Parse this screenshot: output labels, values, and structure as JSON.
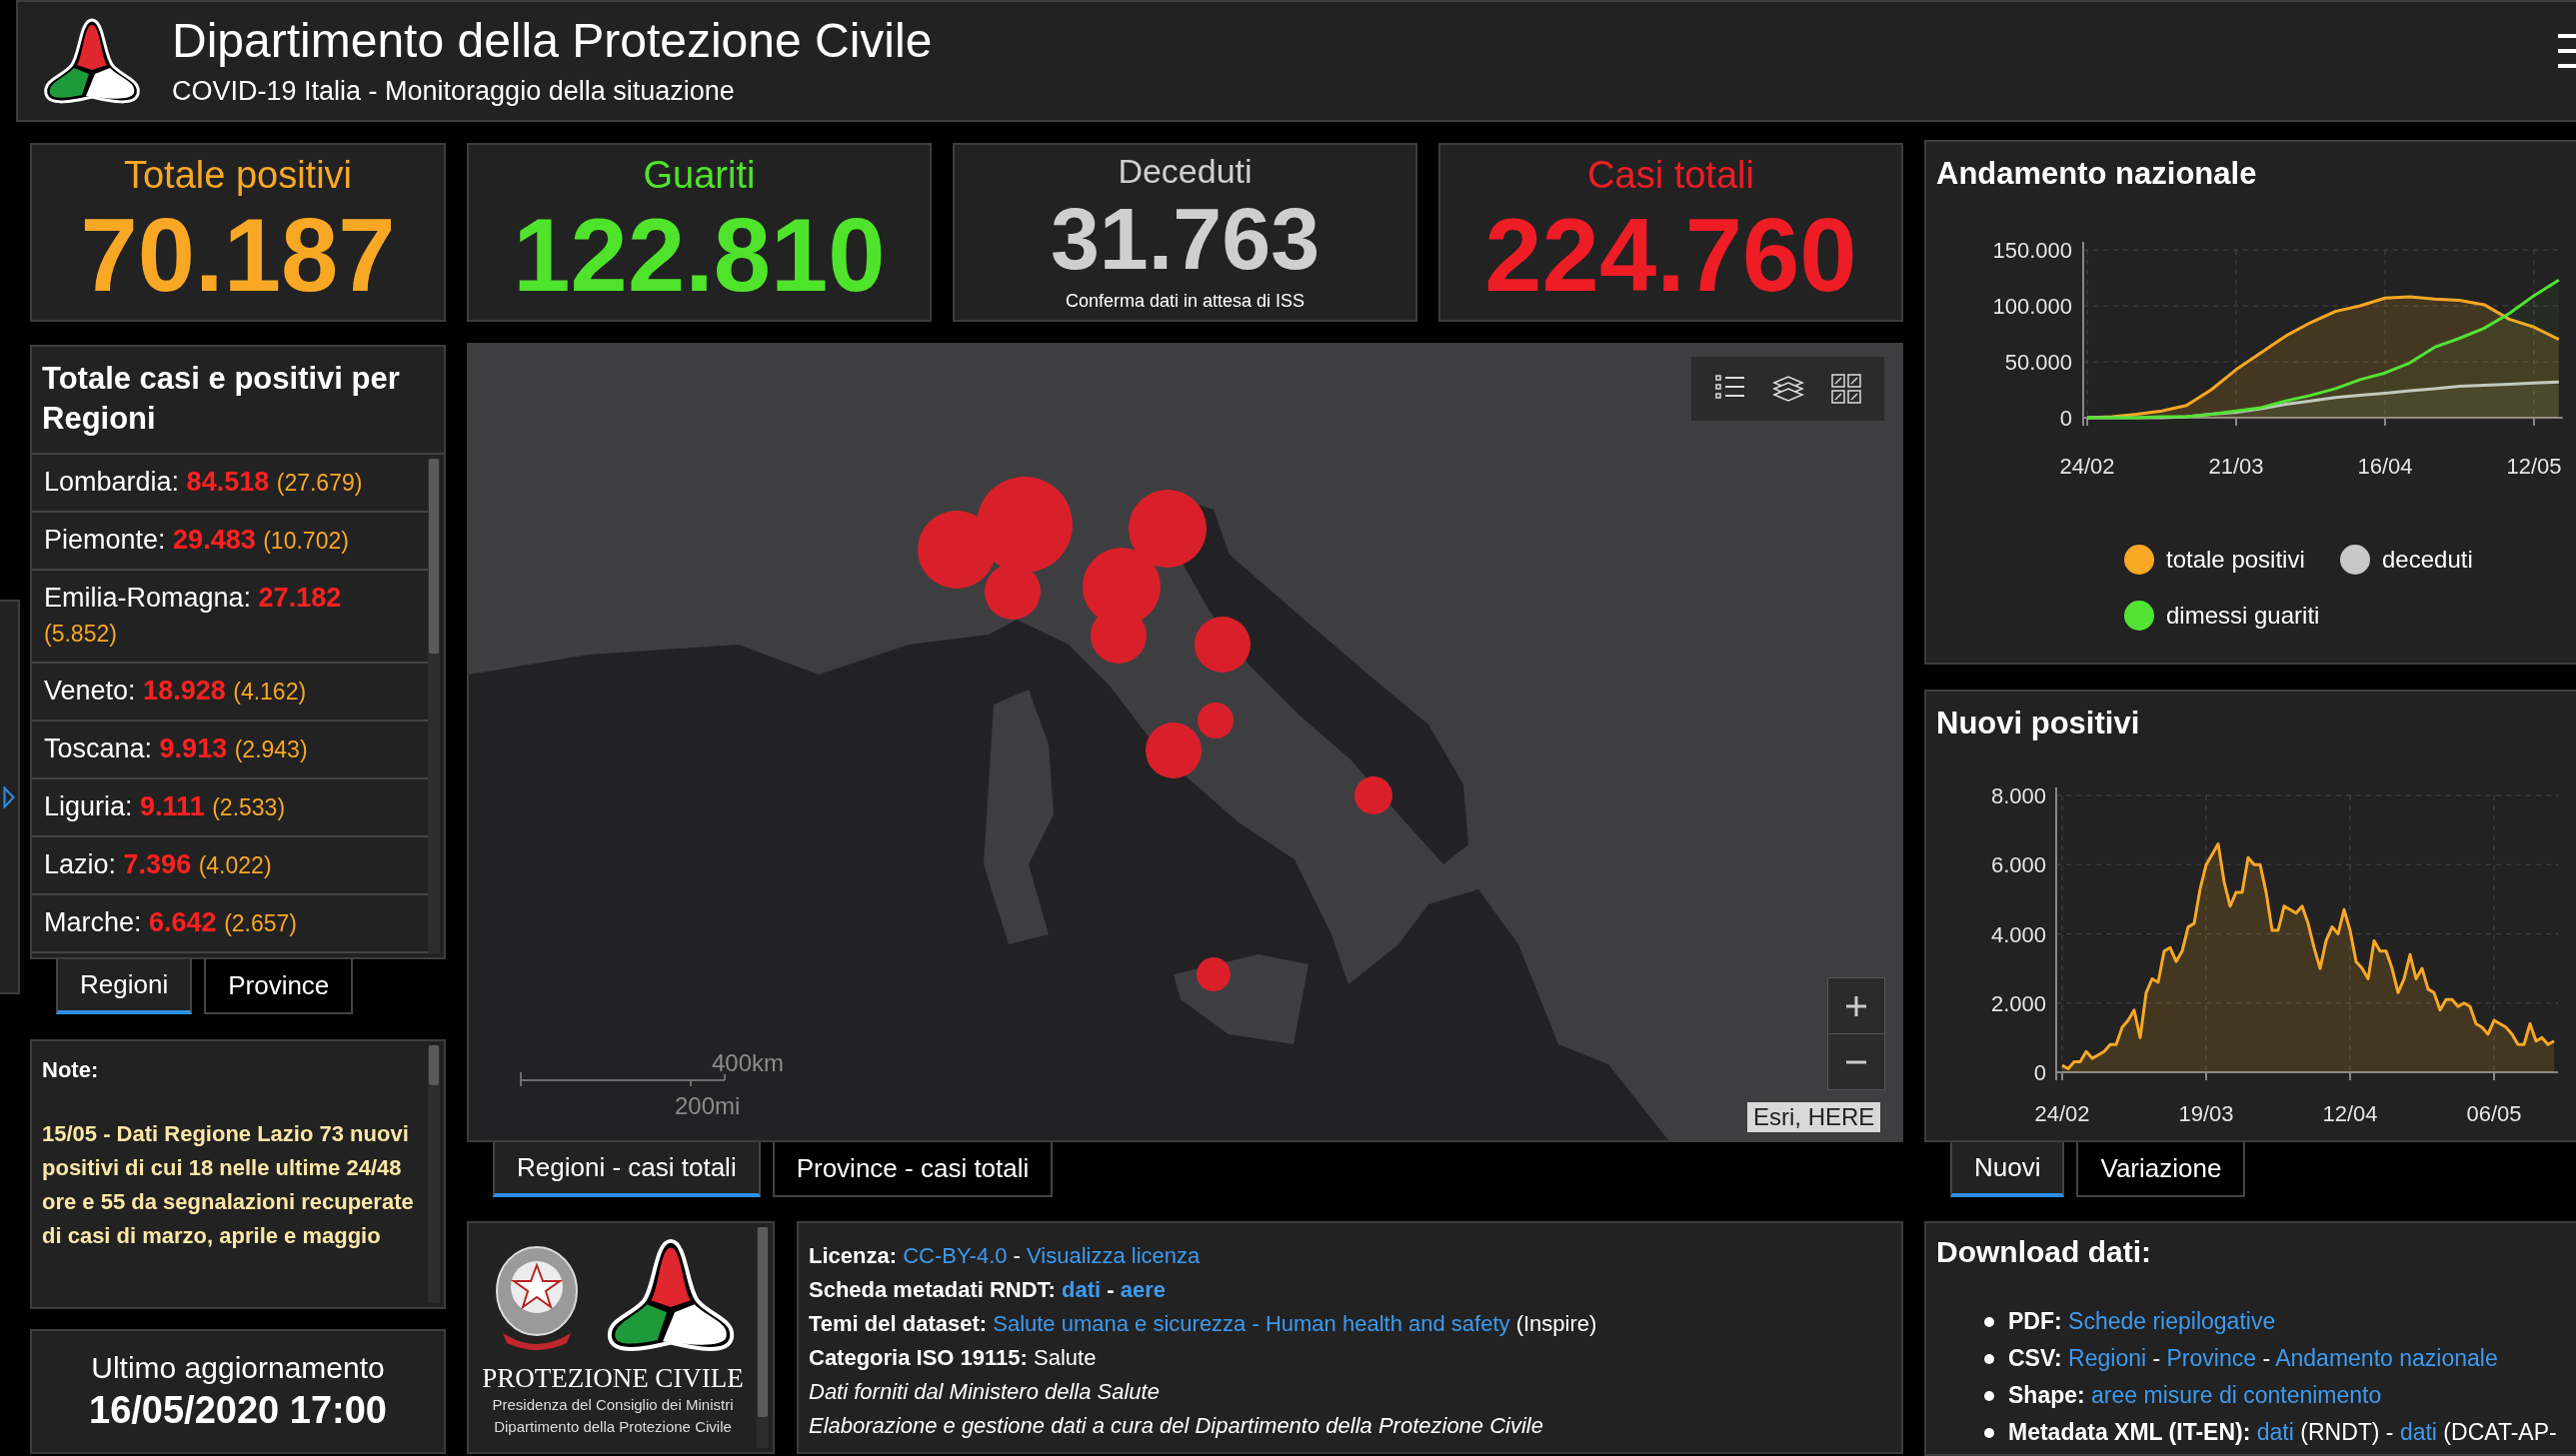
{
  "header": {
    "title": "Dipartimento della Protezione Civile",
    "subtitle": "COVID-19 Italia - Monitoraggio della situazione"
  },
  "stats": [
    {
      "title": "Totale positivi",
      "value": "70.187",
      "color": "#f9a825"
    },
    {
      "title": "Guariti",
      "value": "122.810",
      "color": "#4fe32b"
    },
    {
      "title": "Deceduti",
      "value": "31.763",
      "note": "Conferma dati in attesa di ISS",
      "color": "#cfcfcf"
    },
    {
      "title": "Casi totali",
      "value": "224.760",
      "color": "#ee1c25"
    }
  ],
  "regions_panel": {
    "title": "Totale casi e positivi per Regioni",
    "rows": [
      {
        "name": "Lombardia:",
        "total": "84.518",
        "positives": "(27.679)"
      },
      {
        "name": "Piemonte:",
        "total": "29.483",
        "positives": "(10.702)"
      },
      {
        "name": "Emilia-Romagna:",
        "total": "27.182",
        "positives": "(5.852)"
      },
      {
        "name": "Veneto:",
        "total": "18.928",
        "positives": "(4.162)"
      },
      {
        "name": "Toscana:",
        "total": "9.913",
        "positives": "(2.943)"
      },
      {
        "name": "Liguria:",
        "total": "9.111",
        "positives": "(2.533)"
      },
      {
        "name": "Lazio:",
        "total": "7.396",
        "positives": "(4.022)"
      },
      {
        "name": "Marche:",
        "total": "6.642",
        "positives": "(2.657)"
      }
    ],
    "tabs": [
      {
        "label": "Regioni",
        "selected": true
      },
      {
        "label": "Province",
        "selected": false
      }
    ]
  },
  "notes": {
    "heading": "Note:",
    "text": "15/05 - Dati Regione Lazio 73 nuovi positivi di cui 18 nelle ultime 24/48 ore e 55 da segnalazioni recuperate di casi di marzo, aprile e maggio"
  },
  "update": {
    "label": "Ultimo aggiornamento",
    "value": "16/05/2020 17:00"
  },
  "map": {
    "kind": "picture",
    "scale": [
      "400km",
      "200mi"
    ],
    "attribution": "Esri, HERE",
    "tabs": [
      {
        "label": "Regioni - casi totali",
        "selected": true
      },
      {
        "label": "Province - casi totali",
        "selected": false
      }
    ]
  },
  "logos": {
    "name": "PROTEZIONE CIVILE",
    "lines": [
      "Presidenza del Consiglio dei Ministri",
      "Dipartimento della Protezione Civile"
    ]
  },
  "info": {
    "lines": [
      {
        "kind": "field",
        "bold": false,
        "label": "Licenza:",
        "parts": [
          {
            "kind": "link",
            "text": "CC-BY-4.0"
          },
          {
            "kind": "text",
            "text": " - "
          },
          {
            "kind": "link",
            "text": "Visualizza licenza"
          }
        ]
      },
      {
        "kind": "field",
        "bold": true,
        "label": "Scheda metadati RNDT:",
        "parts": [
          {
            "kind": "link",
            "text": "dati"
          },
          {
            "kind": "text",
            "text": " - "
          },
          {
            "kind": "link",
            "text": "aere"
          }
        ]
      },
      {
        "kind": "field",
        "bold": false,
        "label": "Temi del dataset:",
        "parts": [
          {
            "kind": "link",
            "text": "Salute umana e sicurezza - Human health and safety"
          },
          {
            "kind": "text",
            "text": " (Inspire)"
          }
        ]
      },
      {
        "kind": "field",
        "bold": false,
        "label": "Categoria ISO 19115:",
        "parts": [
          {
            "kind": "text",
            "text": "Salute"
          }
        ]
      },
      {
        "kind": "italic",
        "text": "Dati forniti dal Ministero della Salute"
      },
      {
        "kind": "italic",
        "text": "Elaborazione e gestione dati a cura del Dipartimento della Protezione Civile"
      }
    ]
  },
  "trend_panel": {
    "title": "Andamento nazionale",
    "chart_data": {
      "type": "area",
      "grid": true,
      "categories": [
        "24/02",
        null,
        null,
        null,
        null,
        null,
        "21/03",
        null,
        null,
        null,
        null,
        null,
        "16/04",
        null,
        null,
        null,
        null,
        null,
        "12/05",
        null
      ],
      "ylim": [
        0,
        150
      ],
      "yticks": [
        {
          "value": 0,
          "label": "0"
        },
        {
          "value": 50,
          "label": "50.000"
        },
        {
          "value": 100,
          "label": "100.000"
        },
        {
          "value": 150,
          "label": "150.000"
        }
      ],
      "series": [
        {
          "name": "totale positivi",
          "color": "#f9a825",
          "values": [
            0,
            1,
            3,
            6,
            11,
            25,
            43,
            58,
            73,
            85,
            95,
            100,
            107,
            108,
            106,
            105,
            101,
            88,
            81,
            70
          ]
        },
        {
          "name": "deceduti",
          "color": "#c8c8c8",
          "values": [
            0,
            0,
            0,
            0,
            1,
            3,
            5,
            8,
            12,
            15,
            18,
            20,
            22,
            24,
            26,
            28,
            29,
            30,
            31,
            32
          ]
        },
        {
          "name": "dimessi guariti",
          "color": "#52e334",
          "values": [
            0,
            0,
            0,
            1,
            1,
            3,
            6,
            9,
            15,
            20,
            26,
            34,
            40,
            49,
            63,
            71,
            80,
            93,
            109,
            123
          ]
        }
      ]
    }
  },
  "new_panel": {
    "title": "Nuovi positivi",
    "chart_data": {
      "type": "area",
      "grid": true,
      "ylim": [
        0,
        8
      ],
      "categories": [
        "24/02",
        null,
        null,
        null,
        null,
        null,
        null,
        null,
        null,
        null,
        null,
        null,
        null,
        null,
        null,
        null,
        null,
        null,
        null,
        null,
        null,
        null,
        null,
        null,
        "19/03",
        null,
        null,
        null,
        null,
        null,
        null,
        null,
        null,
        null,
        null,
        null,
        null,
        null,
        null,
        null,
        null,
        null,
        null,
        null,
        null,
        null,
        null,
        null,
        "12/04",
        null,
        null,
        null,
        null,
        null,
        null,
        null,
        null,
        null,
        null,
        null,
        null,
        null,
        null,
        null,
        null,
        null,
        null,
        null,
        null,
        null,
        null,
        null,
        "06/05",
        null,
        null,
        null,
        null,
        null,
        null,
        null,
        null,
        null,
        null
      ],
      "values": [
        0.2,
        0.1,
        0.3,
        0.3,
        0.6,
        0.4,
        0.5,
        0.6,
        0.8,
        0.8,
        1.3,
        1.5,
        1.8,
        1.0,
        2.3,
        2.7,
        2.6,
        3.5,
        3.6,
        3.2,
        3.5,
        4.2,
        4.3,
        5.3,
        6.0,
        6.3,
        6.6,
        5.5,
        4.8,
        5.2,
        5.2,
        6.2,
        6.0,
        6.0,
        5.2,
        4.1,
        4.1,
        4.8,
        4.7,
        4.6,
        4.8,
        4.3,
        3.6,
        3.0,
        3.8,
        4.2,
        4.0,
        4.7,
        4.1,
        3.2,
        3.0,
        2.7,
        3.8,
        3.5,
        3.5,
        3.0,
        2.3,
        2.7,
        3.4,
        2.7,
        3.0,
        2.4,
        2.3,
        1.8,
        2.1,
        2.1,
        1.9,
        2.0,
        1.9,
        1.4,
        1.3,
        1.1,
        1.5,
        1.4,
        1.3,
        1.1,
        0.8,
        0.8,
        1.4,
        0.9,
        1.0,
        0.8,
        0.9
      ],
      "yticks": [
        {
          "value": 0,
          "label": "0"
        },
        {
          "value": 2,
          "label": "2.000"
        },
        {
          "value": 4,
          "label": "4.000"
        },
        {
          "value": 6,
          "label": "6.000"
        },
        {
          "value": 8,
          "label": "8.000"
        }
      ]
    },
    "tabs": [
      {
        "label": "Nuovi",
        "selected": true
      },
      {
        "label": "Variazione",
        "selected": false
      }
    ]
  },
  "download": {
    "title": "Download dati:",
    "items": [
      {
        "label": "PDF:",
        "parts": [
          {
            "kind": "link",
            "text": "Schede riepilogative"
          }
        ]
      },
      {
        "label": "CSV:",
        "parts": [
          {
            "kind": "link",
            "text": "Regioni"
          },
          {
            "kind": "text",
            "text": " - "
          },
          {
            "kind": "link",
            "text": "Province"
          },
          {
            "kind": "text",
            "text": " - "
          },
          {
            "kind": "link",
            "text": "Andamento nazionale"
          }
        ]
      },
      {
        "label": "Shape:",
        "parts": [
          {
            "kind": "link",
            "text": "aree misure di contenimento"
          }
        ]
      },
      {
        "label": "Metadata XML (IT-EN):",
        "parts": [
          {
            "kind": "link",
            "text": "dati"
          },
          {
            "kind": "text",
            "text": " (RNDT) - "
          },
          {
            "kind": "link",
            "text": "dati"
          },
          {
            "kind": "text",
            "text": " (DCAT-AP-"
          }
        ]
      }
    ]
  }
}
